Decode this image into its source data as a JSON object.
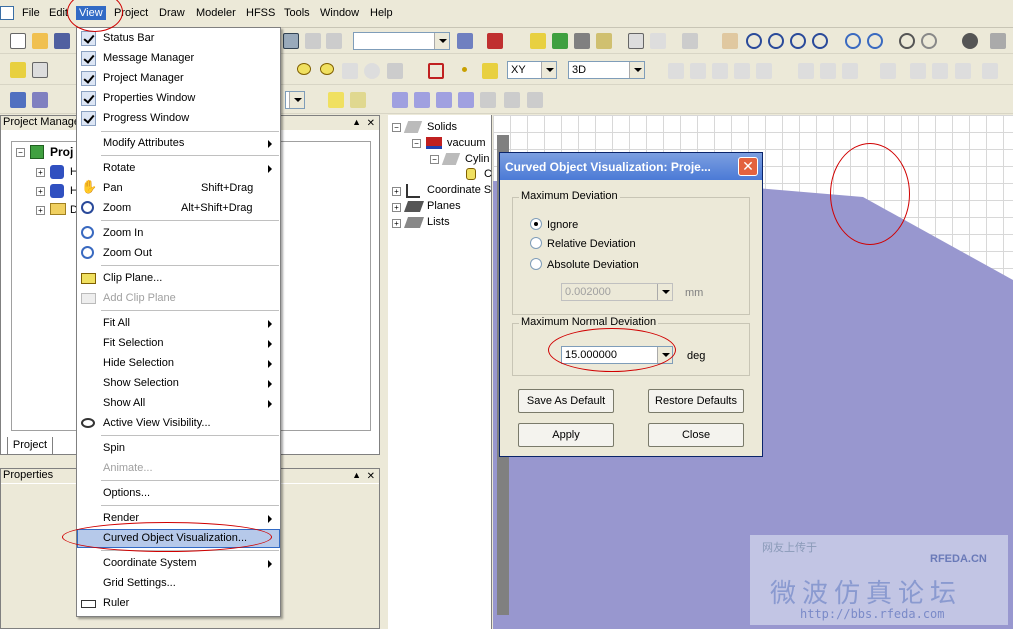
{
  "menubar": [
    "File",
    "Edit",
    "View",
    "Project",
    "Draw",
    "Modeler",
    "HFSS",
    "Tools",
    "Window",
    "Help"
  ],
  "toolbar": {
    "combo_empty": "",
    "plane_combo": "XY",
    "view_combo": "3D"
  },
  "project_manager": {
    "title": "Project Manage",
    "root": "Proj",
    "child_h1": "H",
    "child_h2": "H",
    "child_d": "D",
    "tab": "Project"
  },
  "properties": {
    "title": "Properties"
  },
  "model_tree": {
    "solids": "Solids",
    "vacuum": "vacuum",
    "cylin": "Cylin",
    "cyl_item": "C",
    "coord": "Coordinate S",
    "planes": "Planes",
    "lists": "Lists"
  },
  "view_menu": {
    "status_bar": "Status Bar",
    "message_manager": "Message Manager",
    "project_manager": "Project Manager",
    "properties_window": "Properties Window",
    "progress_window": "Progress Window",
    "modify_attributes": "Modify Attributes",
    "rotate": "Rotate",
    "pan": "Pan",
    "pan_acc": "Shift+Drag",
    "zoom": "Zoom",
    "zoom_acc": "Alt+Shift+Drag",
    "zoom_in": "Zoom In",
    "zoom_out": "Zoom Out",
    "clip_plane": "Clip Plane...",
    "add_clip_plane": "Add Clip Plane",
    "fit_all": "Fit All",
    "fit_selection": "Fit Selection",
    "hide_selection": "Hide Selection",
    "show_selection": "Show Selection",
    "show_all": "Show All",
    "active_view_visibility": "Active View Visibility...",
    "spin": "Spin",
    "animate": "Animate...",
    "options": "Options...",
    "render": "Render",
    "curved_object_visualization": "Curved Object Visualization...",
    "coordinate_system": "Coordinate System",
    "grid_settings": "Grid Settings...",
    "ruler": "Ruler"
  },
  "dialog": {
    "title": "Curved Object Visualization: Proje...",
    "close_glyph": "✕",
    "max_deviation_group": "Maximum Deviation",
    "opt_ignore": "Ignore",
    "opt_relative": "Relative Deviation",
    "opt_absolute": "Absolute Deviation",
    "deviation_value": "0.002000",
    "deviation_unit": "mm",
    "max_normal_group": "Maximum Normal Deviation",
    "normal_value": "15.000000",
    "normal_unit": "deg",
    "btn_save_default": "Save As Default",
    "btn_restore": "Restore Defaults",
    "btn_apply": "Apply",
    "btn_close": "Close"
  },
  "watermark": {
    "line1": "网友上传于",
    "brand": "RFEDA.CN",
    "line2": "微波仿真论坛",
    "url": "http://bbs.rfeda.com"
  },
  "colors": {
    "model_fill": "#9897cf",
    "highlight": "#316ac5",
    "annot_red": "#d00000"
  }
}
